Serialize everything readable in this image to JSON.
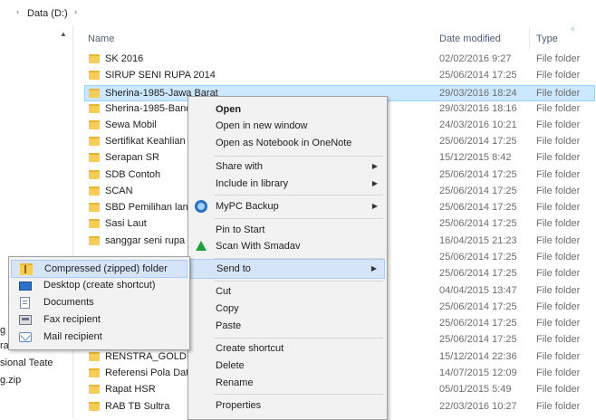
{
  "address_bar": {
    "prefix": "›",
    "drive": "Data (D:)",
    "suffix": "›"
  },
  "columns": {
    "name": "Name",
    "date_modified": "Date modified",
    "type": "Type"
  },
  "left_nav": {
    "item_1": "g",
    "item_2": "ra",
    "item_3": "sional Teate",
    "item_4": "g.zip"
  },
  "files": [
    {
      "name": "SK 2016",
      "date": "02/02/2016 9:27",
      "type": "File folder"
    },
    {
      "name": "SIRUP SENI RUPA 2014",
      "date": "25/06/2014 17:25",
      "type": "File folder"
    },
    {
      "name": "Sherina-1985-Jawa Barat",
      "date": "29/03/2016 18:24",
      "type": "File folder"
    },
    {
      "name": "Sherina-1985-Bandu",
      "date": "29/03/2016 18:16",
      "type": "File folder"
    },
    {
      "name": "Sewa Mobil",
      "date": "24/03/2016 10:21",
      "type": "File folder"
    },
    {
      "name": "Sertifikat Keahlian ko",
      "date": "25/06/2014 17:25",
      "type": "File folder"
    },
    {
      "name": "Serapan SR",
      "date": "15/12/2015 8:42",
      "type": "File folder"
    },
    {
      "name": "SDB Contoh",
      "date": "25/06/2014 17:25",
      "type": "File folder"
    },
    {
      "name": "SCAN",
      "date": "25/06/2014 17:25",
      "type": "File folder"
    },
    {
      "name": "SBD Pemilihan langs",
      "date": "25/06/2014 17:25",
      "type": "File folder"
    },
    {
      "name": "Sasi Laut",
      "date": "25/06/2014 17:25",
      "type": "File folder"
    },
    {
      "name": "sanggar seni rupa 55",
      "date": "16/04/2015 21:23",
      "type": "File folder"
    },
    {
      "name": "",
      "date": "25/06/2014 17:25",
      "type": "File folder"
    },
    {
      "name": "",
      "date": "25/06/2014 17:25",
      "type": "File folder"
    },
    {
      "name": "",
      "date": "04/04/2015 13:47",
      "type": "File folder"
    },
    {
      "name": "",
      "date": "25/06/2014 17:25",
      "type": "File folder"
    },
    {
      "name": "",
      "date": "25/06/2014 17:25",
      "type": "File folder"
    },
    {
      "name": "",
      "date": "25/06/2014 17:25",
      "type": "File folder"
    },
    {
      "name": "RENSTRA_GOLDEN_",
      "date": "15/12/2014 22:36",
      "type": "File folder"
    },
    {
      "name": "Referensi Pola Data",
      "date": "14/07/2015 12:09",
      "type": "File folder"
    },
    {
      "name": "Rapat HSR",
      "date": "05/01/2015 5:49",
      "type": "File folder"
    },
    {
      "name": "RAB TB Sultra",
      "date": "22/03/2016 10:27",
      "type": "File folder"
    }
  ],
  "context_menu": {
    "open": "Open",
    "open_new_window": "Open in new window",
    "open_notebook": "Open as Notebook in OneNote",
    "share_with": "Share with",
    "include_in_library": "Include in library",
    "mypc_backup": "MyPC Backup",
    "pin_to_start": "Pin to Start",
    "scan_smadav": "Scan With Smadav",
    "send_to": "Send to",
    "cut": "Cut",
    "copy": "Copy",
    "paste": "Paste",
    "create_shortcut": "Create shortcut",
    "delete": "Delete",
    "rename": "Rename",
    "properties": "Properties"
  },
  "send_to_menu": {
    "compressed": "Compressed (zipped) folder",
    "desktop": "Desktop (create shortcut)",
    "documents": "Documents",
    "fax": "Fax recipient",
    "mail": "Mail recipient"
  },
  "colors": {
    "selection": "#cce8ff",
    "menu_bg": "#f2f2f2",
    "menu_highlight": "#d5e4f7",
    "folder": "#f5cd57"
  }
}
